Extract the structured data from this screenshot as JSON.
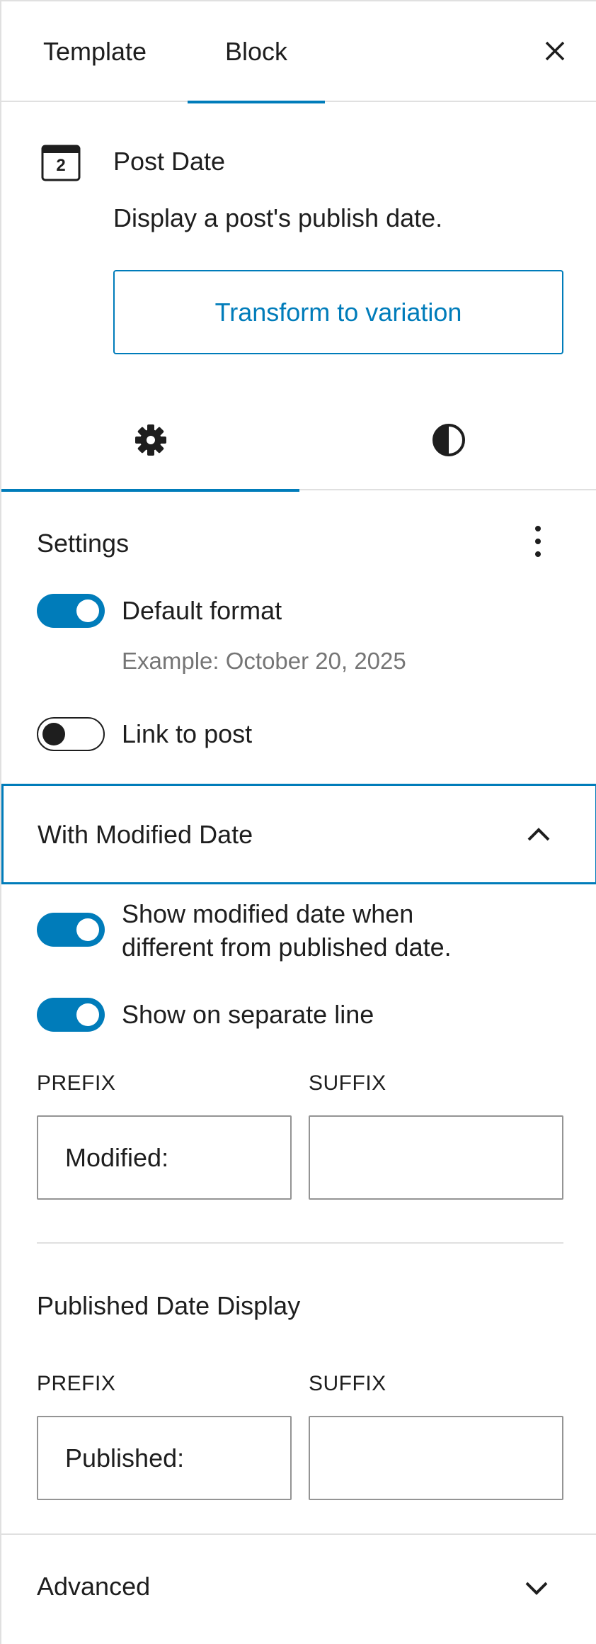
{
  "tabs": {
    "template": "Template",
    "block": "Block"
  },
  "block": {
    "icon_number": "2",
    "title": "Post Date",
    "description": "Display a post's publish date.",
    "transform_label": "Transform to variation"
  },
  "icons": {
    "settings": "gear-icon",
    "styles": "contrast-icon",
    "close": "close-icon",
    "more": "kebab-menu-icon"
  },
  "settings": {
    "title": "Settings",
    "default_format": {
      "label": "Default format",
      "enabled": true
    },
    "example_text": "Example: October 20, 2025",
    "link_to_post": {
      "label": "Link to post",
      "enabled": false
    }
  },
  "modified_date": {
    "title": "With Modified Date",
    "expanded": true,
    "show_modified_line1": "Show modified date when",
    "show_modified_line2": "different from published date.",
    "show_modified_enabled": true,
    "separate_line": {
      "label": "Show on separate line",
      "enabled": true
    },
    "prefix_label": "PREFIX",
    "suffix_label": "SUFFIX",
    "prefix_value": "Modified:",
    "suffix_value": ""
  },
  "published_date": {
    "title": "Published Date Display",
    "prefix_label": "PREFIX",
    "suffix_label": "SUFFIX",
    "prefix_value": "Published:",
    "suffix_value": ""
  },
  "advanced": {
    "title": "Advanced",
    "expanded": false
  },
  "colors": {
    "accent": "#007cba",
    "text": "#1e1e1e",
    "muted": "#757575",
    "border": "#e0e0e0"
  }
}
